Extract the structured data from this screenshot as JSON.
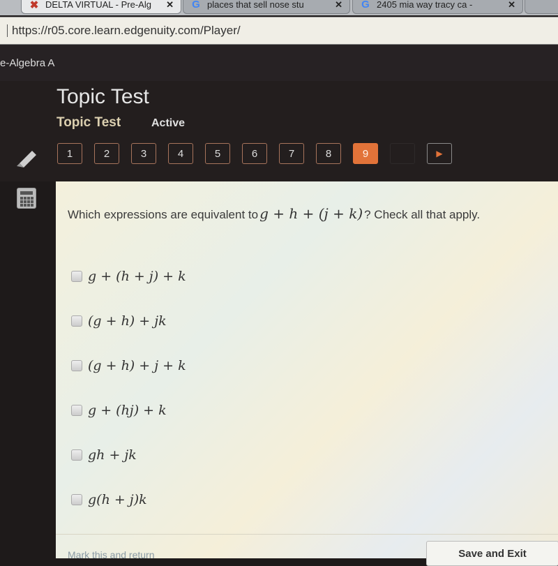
{
  "browser": {
    "tabs": [
      {
        "title": "DELTA VIRTUAL - Pre-Alg",
        "favicon": "x-icon",
        "active": true
      },
      {
        "title": "places that sell nose stu",
        "favicon": "google-icon",
        "active": false
      },
      {
        "title": "2405 mia way tracy ca -",
        "favicon": "google-icon",
        "active": false
      }
    ],
    "close_glyph": "✕",
    "url": "https://r05.core.learn.edgenuity.com/Player/"
  },
  "app": {
    "course": "e-Algebra A",
    "title": "Topic Test",
    "subtitle": "Topic Test",
    "status": "Active"
  },
  "question_nav": {
    "buttons": [
      "1",
      "2",
      "3",
      "4",
      "5",
      "6",
      "7",
      "8",
      "9",
      ""
    ],
    "current": "9",
    "next_glyph": "▶"
  },
  "tools": {
    "pencil": "pencil-icon",
    "calculator": "calculator-icon"
  },
  "question": {
    "prompt": "Which expressions are equivalent to",
    "expression": "g + h + (j + k)",
    "suffix": "? Check all that apply.",
    "options": [
      {
        "label": "g + (h + j) + k",
        "checked": false
      },
      {
        "label": "(g + h) + jk",
        "checked": false
      },
      {
        "label": "(g + h) + j + k",
        "checked": false
      },
      {
        "label": "g + (hj) + k",
        "checked": false
      },
      {
        "label": "gh + jk",
        "checked": false
      },
      {
        "label": "g(h + j)k",
        "checked": false
      }
    ]
  },
  "footer": {
    "mark_return": "Mark this and return",
    "save_exit": "Save and Exit"
  },
  "colors": {
    "accent": "#e27339",
    "header_bg": "#231e1e"
  }
}
